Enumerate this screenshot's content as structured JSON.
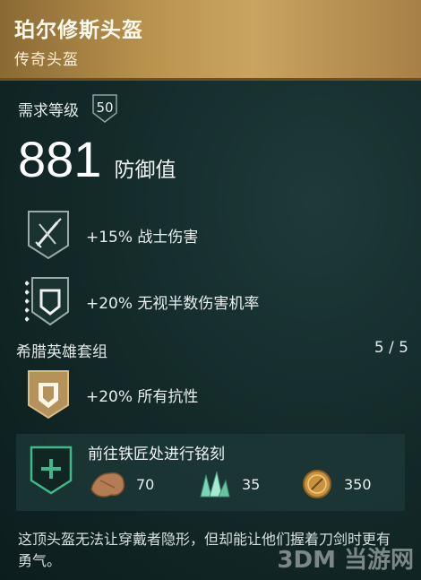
{
  "item": {
    "name": "珀尔修斯头盔",
    "rarity": "传奇头盔"
  },
  "requirement": {
    "label": "需求等级",
    "level": "50"
  },
  "armor": {
    "value": "881",
    "label": "防御值"
  },
  "perks": [
    {
      "text": "+15% 战士伤害",
      "icon": "crossed-swords-icon"
    },
    {
      "text": "+20% 无视半数伤害机率",
      "icon": "shield-icon"
    }
  ],
  "set": {
    "name": "希腊英雄套组",
    "progress": "5 / 5",
    "bonus": {
      "text": "+20% 所有抗性",
      "icon": "gold-shield-icon"
    }
  },
  "engrave": {
    "title": "前往铁匠处进行铭刻",
    "materials": [
      {
        "name": "leather-icon",
        "amount": "70"
      },
      {
        "name": "crystal-icon",
        "amount": "35"
      },
      {
        "name": "drachmae-coin-icon",
        "amount": "350"
      }
    ]
  },
  "description": "这顶头盔无法让穿戴者隐形，但却能让他们握着刀剑时更有勇气。",
  "watermark": "3DM 当游网",
  "colors": {
    "header_gold": "#b9924e",
    "accent_teal": "#3fb98a",
    "background": "#142b2a"
  }
}
